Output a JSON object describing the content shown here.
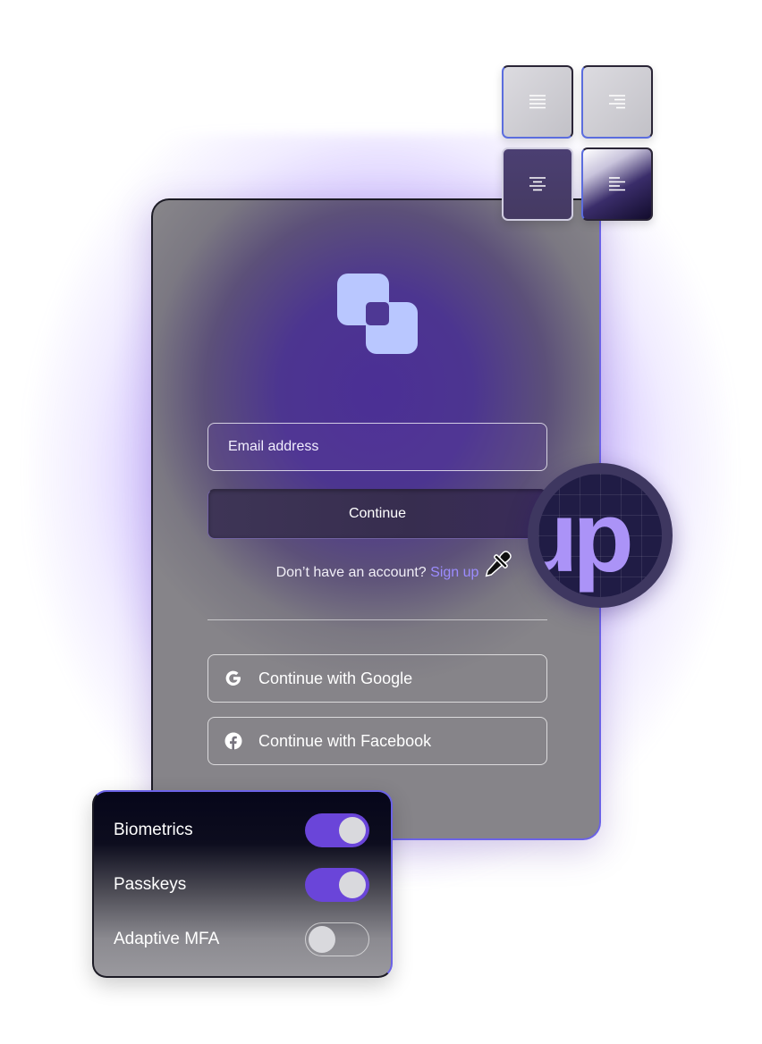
{
  "login": {
    "email_placeholder": "Email address",
    "continue_label": "Continue",
    "signup_prompt": "Don’t have an account? ",
    "signup_link": "Sign up",
    "google_label": "Continue with Google",
    "facebook_label": "Continue with Facebook"
  },
  "alignment_tiles": [
    {
      "icon": "align-center-icon",
      "state": "default"
    },
    {
      "icon": "align-right-icon",
      "state": "default"
    },
    {
      "icon": "align-center-icon",
      "state": "selected"
    },
    {
      "icon": "align-left-icon",
      "state": "gradient"
    }
  ],
  "magnifier": {
    "text": "up"
  },
  "mfa_panel": {
    "items": [
      {
        "label": "Biometrics",
        "enabled": true
      },
      {
        "label": "Passkeys",
        "enabled": true
      },
      {
        "label": "Adaptive MFA",
        "enabled": false
      }
    ]
  },
  "colors": {
    "accent": "#6a45d9",
    "link": "#9c8cff",
    "logo": "#b9c7ff",
    "magnifier_text": "#ab93f7"
  }
}
